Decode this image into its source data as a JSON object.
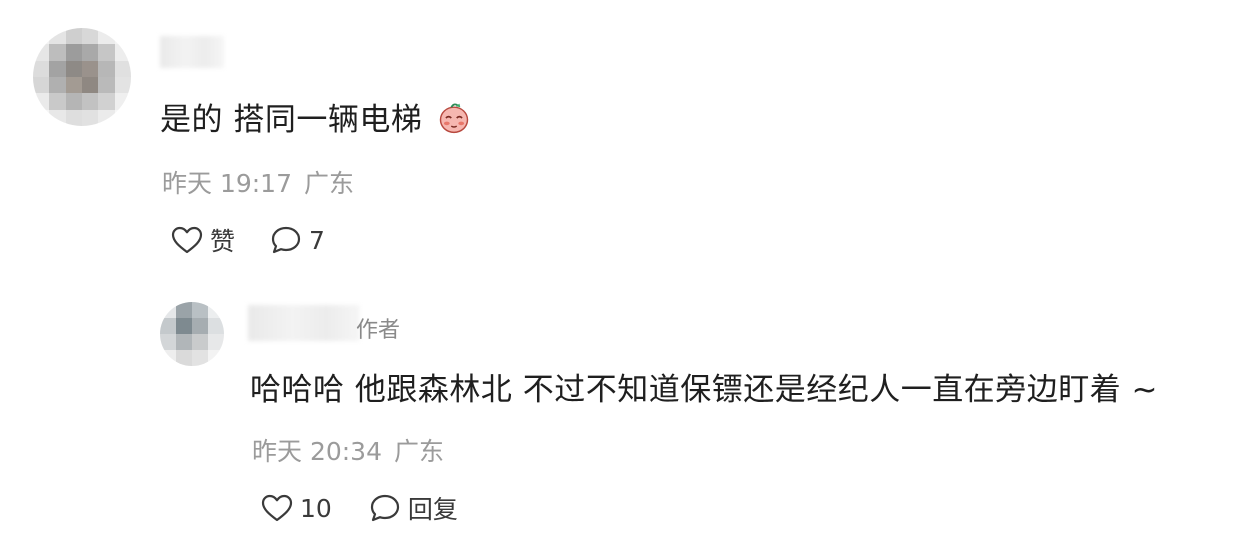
{
  "comments": [
    {
      "text": "是的 搭同一辆电梯",
      "emoji_icon": "blushing-face-emoji-icon",
      "time": "昨天 19:17",
      "location": "广东",
      "like_label": "赞",
      "reply_count": "7"
    }
  ],
  "reply": {
    "author_tag": "作者",
    "text": "哈哈哈 他跟森林北 不过不知道保镖还是经纪人一直在旁边盯着 ~",
    "time": "昨天 20:34",
    "location": "广东",
    "like_count": "10",
    "reply_label": "回复"
  },
  "colors": {
    "text_primary": "#1f1f1f",
    "text_meta": "#9b9b9b",
    "icon": "#3a3a3a",
    "background": "#ffffff"
  }
}
